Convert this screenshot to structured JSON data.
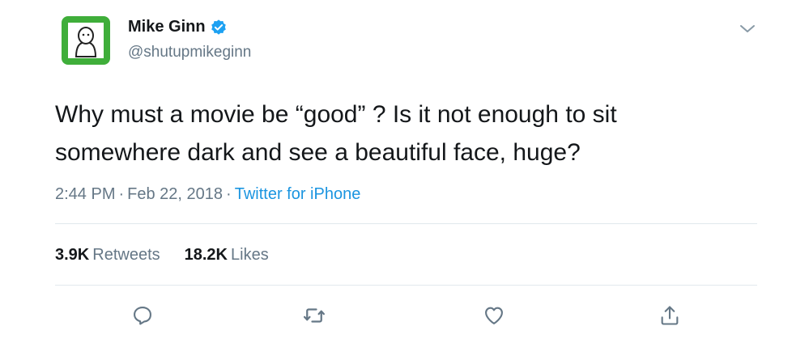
{
  "tweet": {
    "author": {
      "display_name": "Mike Ginn",
      "handle": "@shutupmikeginn",
      "verified": true
    },
    "text_lines": [
      "Why must a movie be “good” ? Is it not enough to sit",
      "somewhere dark and see a beautiful face, huge?"
    ],
    "time": "2:44 PM",
    "separator": "·",
    "date": "Feb 22, 2018",
    "source": "Twitter for iPhone",
    "stats": {
      "retweets_count": "3.9K",
      "retweets_label": "Retweets",
      "likes_count": "18.2K",
      "likes_label": "Likes"
    },
    "actions": [
      "reply-icon",
      "retweet-icon",
      "like-icon",
      "share-icon"
    ]
  },
  "colors": {
    "text": "#14171a",
    "secondary": "#657786",
    "link": "#1b95e0",
    "divider": "#e1e8ed",
    "avatar_bg": "#3fae3a",
    "verified": "#1da1f2"
  }
}
